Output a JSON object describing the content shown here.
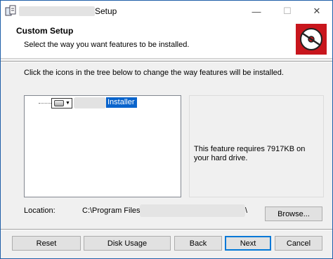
{
  "window": {
    "title_suffix": "Setup",
    "controls": {
      "minimize": "—",
      "maximize": "☐",
      "close": "✕"
    }
  },
  "banner": {
    "title": "Custom Setup",
    "subtitle": "Select the way you want features to be installed."
  },
  "instructions": "Click the icons in the tree below to change the way features will be installed.",
  "tree": {
    "items": [
      {
        "label": "Installer",
        "selected": true
      }
    ]
  },
  "feature_panel": {
    "description": "This feature requires 7917KB on your hard drive."
  },
  "location": {
    "label": "Location:",
    "path_prefix": "C:\\Program Files\\",
    "path_suffix": "\\"
  },
  "buttons": {
    "browse": "Browse...",
    "reset": "Reset",
    "disk_usage": "Disk Usage",
    "back": "Back",
    "next": "Next",
    "cancel": "Cancel"
  },
  "colors": {
    "accent": "#0078d7",
    "logo_bg": "#c8161d",
    "selection": "#0a64cc"
  }
}
